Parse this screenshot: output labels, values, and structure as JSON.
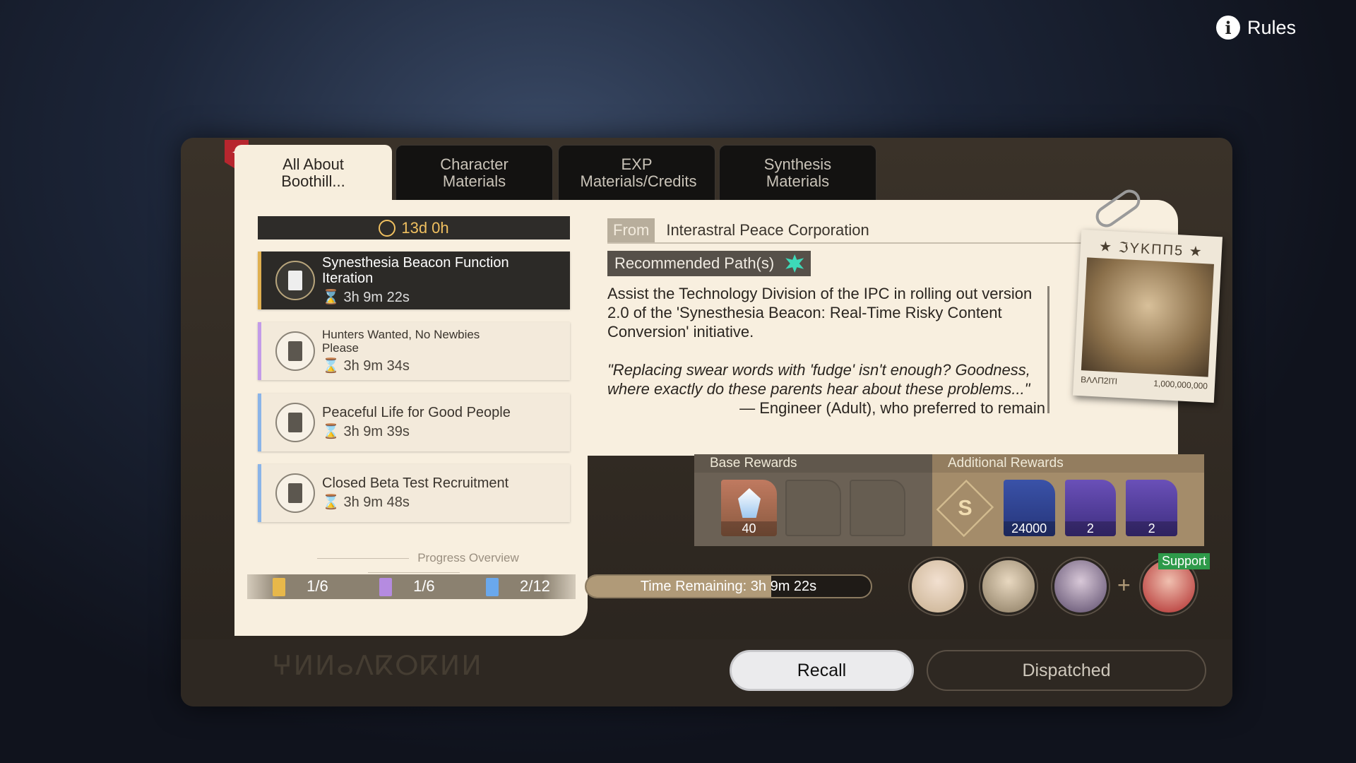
{
  "header": {
    "rules_label": "Rules",
    "rules_icon": "info-icon"
  },
  "tabs": [
    {
      "label": "All About Boothill...",
      "active": true
    },
    {
      "label": "Character Materials"
    },
    {
      "label": "EXP Materials/Credits"
    },
    {
      "label": "Synthesis Materials"
    }
  ],
  "timer": {
    "icon": "clock-icon",
    "value": "13d 0h"
  },
  "quests": [
    {
      "title": "Synesthesia Beacon Function Iteration",
      "time": "3h 9m 22s",
      "selected": true
    },
    {
      "title": "Hunters Wanted, No Newbies Please",
      "time": "3h 9m 34s"
    },
    {
      "title": "Peaceful Life for Good People",
      "time": "3h 9m 39s"
    },
    {
      "title": "Closed Beta Test Recruitment",
      "time": "3h 9m 48s"
    }
  ],
  "progress": {
    "title": "Progress Overview",
    "items": [
      {
        "value": "1/6",
        "color": "#e8b84a"
      },
      {
        "value": "1/6",
        "color": "#b58be0"
      },
      {
        "value": "2/12",
        "color": "#6aa8ec"
      }
    ]
  },
  "detail": {
    "from_label": "From",
    "from_value": "Interastral Peace Corporation",
    "recommended_label": "Recommended Path(s)",
    "path_color": "#3dd9b8",
    "description": "Assist the Technology Division of the IPC in rolling out version 2.0 of the 'Synesthesia Beacon: Real-Time Risky Content Conversion' initiative.",
    "quote": "\"Replacing swear words with 'fudge' isn't enough? Goodness, where exactly do these parents hear about these problems...\"",
    "attribution": "— Engineer (Adult), who preferred to remain"
  },
  "poster": {
    "title": "★ ℑΥΚΠΠ5 ★",
    "label": "ΒΛΛΠ2ΙΊΊ",
    "bounty": "1,000,000,000"
  },
  "rewards": {
    "base_label": "Base Rewards",
    "base_items": [
      {
        "count": "40",
        "kind": "crystal"
      }
    ],
    "additional_label": "Additional Rewards",
    "grade": "S",
    "additional_items": [
      {
        "count": "24000",
        "kind": "credits"
      },
      {
        "count": "2",
        "kind": "exp-book"
      },
      {
        "count": "2",
        "kind": "ore"
      }
    ]
  },
  "dispatch": {
    "time_remaining": "Time Remaining: 3h 9m 22s",
    "progress_percent": 65,
    "support_label": "Support"
  },
  "buttons": {
    "recall": "Recall",
    "dispatched": "Dispatched"
  }
}
